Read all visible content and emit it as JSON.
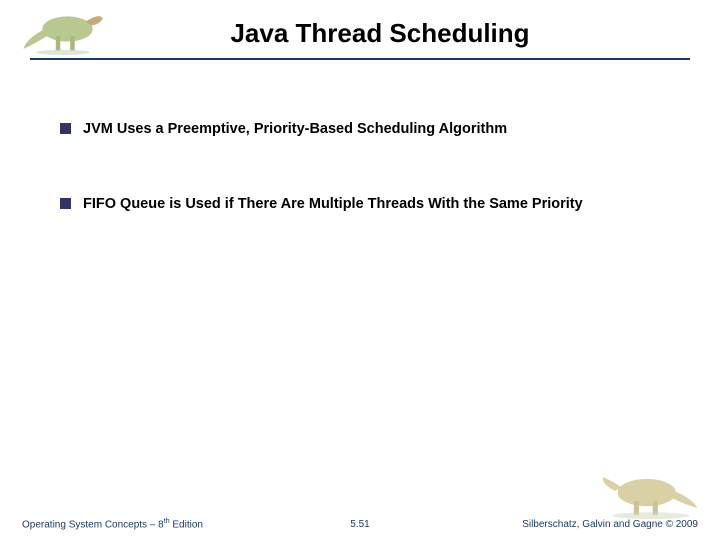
{
  "title": "Java Thread Scheduling",
  "bullets": [
    "JVM Uses a Preemptive, Priority-Based Scheduling Algorithm",
    "FIFO Queue is Used if There Are Multiple Threads With the Same Priority"
  ],
  "footer": {
    "left_prefix": "Operating System Concepts – 8",
    "left_suffix": " Edition",
    "left_sup": "th",
    "center": "5.51",
    "right": "Silberschatz, Galvin and Gagne © 2009"
  },
  "icons": {
    "dino_top": "dinosaur-illustration-top",
    "dino_bottom": "dinosaur-illustration-bottom"
  }
}
